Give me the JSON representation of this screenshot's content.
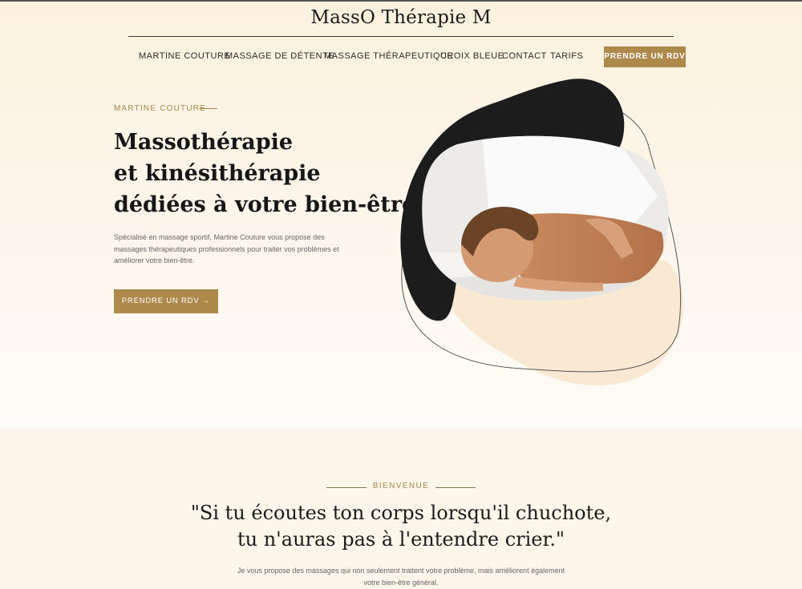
{
  "brand": {
    "title": "MassO Thérapie M"
  },
  "nav": {
    "items": [
      {
        "label": "MARTINE COUTURE"
      },
      {
        "label": "MASSAGE DE DÉTENTE"
      },
      {
        "label": "MASSAGE THÉRAPEUTIQUE"
      },
      {
        "label": "CROIX BLEUE"
      },
      {
        "label": "CONTACT"
      },
      {
        "label": "TARIFS"
      }
    ],
    "cta_label": "PRENDRE UN RDV"
  },
  "hero": {
    "eyebrow": "MARTINE COUTURE",
    "title_lines": [
      "Massothérapie",
      "et kinésithérapie",
      "dédiées à votre bien-être"
    ],
    "description": "Spécialisé en massage sportif, Martine Couture vous propose des massages thérapeutiques professionnels pour traiter vos problèmes et améliorer votre bien-être.",
    "cta_label": "PRENDRE UN RDV →"
  },
  "welcome": {
    "eyebrow": "BIENVENUE",
    "quote_lines": [
      "\"Si tu écoutes ton corps lorsqu'il chuchote,",
      "tu n'auras pas à l'entendre crier.\""
    ],
    "intro_lines": [
      "Je vous propose des massages qui non seulement traitent votre problème, mais améliorent également",
      "votre bien-être général."
    ]
  },
  "colors": {
    "accent_gold": "#ad8a4c",
    "hero_bg": "#fcf1de",
    "section_bg": "#fdf3e4",
    "blob_dark": "#1c1c1c"
  },
  "icons": {
    "cta_arrow": "arrow-right-icon"
  }
}
